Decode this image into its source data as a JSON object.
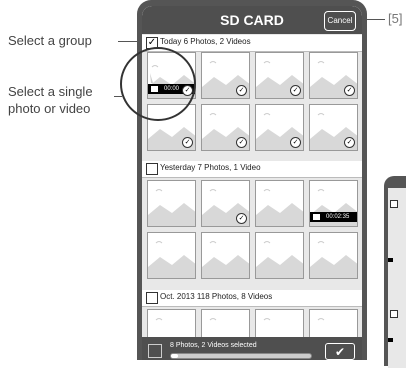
{
  "callouts": {
    "select_group": "Select a group",
    "select_single_line1": "Select a single",
    "select_single_line2": "photo or video",
    "cancel_ref": "[5]"
  },
  "header": {
    "title": "SD CARD",
    "cancel_label": "Cancel"
  },
  "groups": [
    {
      "label": "Today 6 Photos, 2 Videos",
      "checked": true
    },
    {
      "label": "Yesterday 7 Photos, 1 Video",
      "checked": false
    },
    {
      "label": "Oct. 2013 118 Photos, 8 Videos",
      "checked": false
    }
  ],
  "thumb_labels": {
    "check": "✓",
    "video_time_1": "00:00",
    "video_time_2": "00:02:35"
  },
  "footer": {
    "selection_label": "8 Photos, 2 Videos selected",
    "confirm_label": "✔",
    "progress_fraction": 0.05
  },
  "colors": {
    "bar": "#4f4f4f",
    "background": "#e8e8e8"
  }
}
